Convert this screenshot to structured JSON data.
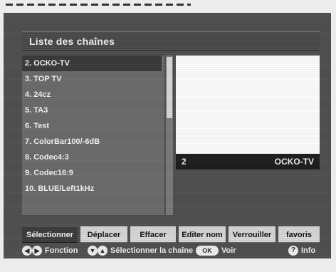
{
  "title": "Liste des chaînes",
  "channels": [
    "2. OCKO-TV",
    "3. TOP TV",
    "4. 24cz",
    "5. TA3",
    "6. Test",
    "7. ColorBar100/-6dB",
    "8. Codec4:3",
    "9. Codec16:9",
    "10. BLUE/Left1kHz"
  ],
  "selected_index": 0,
  "scroll_thumb_position": 0.0,
  "preview": {
    "number": "2",
    "name": "OCKO-TV"
  },
  "function_buttons": [
    "Sélectionner",
    "Déplacer",
    "Effacer",
    "Editer nom",
    "Verrouiller",
    "favoris"
  ],
  "active_button_index": 0,
  "help": {
    "fonction_label": "Fonction",
    "select_label": "Sélectionner la chaîne",
    "ok_key": "OK",
    "voir_label": "Voir",
    "info_key": "?",
    "info_label": "Info",
    "left_icon": "left-arrow-icon",
    "right_icon": "right-arrow-icon",
    "down_icon": "down-arrow-icon",
    "up_icon": "up-arrow-icon"
  },
  "colors": {
    "background": "#505050",
    "selected_row": "#3a3a3a",
    "button": "#d8d8d8",
    "active_button": "#3c3c3c",
    "preview": "#ffffff"
  }
}
